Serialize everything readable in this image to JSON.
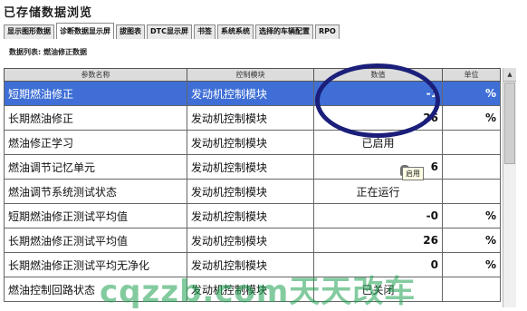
{
  "window": {
    "title": "已存储数据浏览"
  },
  "tabs": [
    {
      "label": "显示图形数据",
      "active": false
    },
    {
      "label": "诊断数据显示屏",
      "active": true
    },
    {
      "label": "拔图表",
      "active": false
    },
    {
      "label": "DTC显示屏",
      "active": false
    },
    {
      "label": "书签",
      "active": false
    },
    {
      "label": "系统系统",
      "active": false
    },
    {
      "label": "选择的车辆配置",
      "active": false
    },
    {
      "label": "RPO",
      "active": false
    }
  ],
  "list_label": "数据列表: 燃油修正数据",
  "table": {
    "headers": [
      "参数名称",
      "控制模块",
      "数值",
      "单位"
    ],
    "rows": [
      {
        "name": "短期燃油修正",
        "module": "发动机控制模块",
        "value": "-1",
        "unit": "%",
        "selected": true
      },
      {
        "name": "长期燃油修正",
        "module": "发动机控制模块",
        "value": "26",
        "unit": "%"
      },
      {
        "name": "燃油修正学习",
        "module": "发动机控制模块",
        "value": "已启用",
        "unit": ""
      },
      {
        "name": "燃油调节记忆单元",
        "module": "发动机控制模块",
        "value": "6",
        "unit": ""
      },
      {
        "name": "燃油调节系统测试状态",
        "module": "发动机控制模块",
        "value": "正在运行",
        "unit": ""
      },
      {
        "name": "短期燃油修正测试平均值",
        "module": "发动机控制模块",
        "value": "-0",
        "unit": "%"
      },
      {
        "name": "长期燃油修正测试平均值",
        "module": "发动机控制模块",
        "value": "26",
        "unit": "%"
      },
      {
        "name": "长期燃油修正测试平均无净化",
        "module": "发动机控制模块",
        "value": "0",
        "unit": "%"
      },
      {
        "name": "燃油控制回路状态",
        "module": "发动机控制模块",
        "value": "已关闭",
        "unit": ""
      }
    ]
  },
  "tooltip": "启用",
  "watermark": "cqzzb.com天天改车"
}
